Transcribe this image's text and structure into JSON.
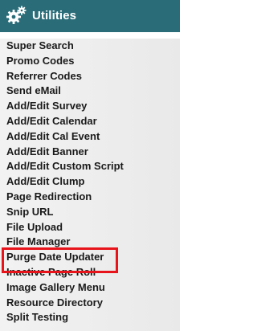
{
  "header": {
    "title": "Utilities",
    "icon": "gears-icon",
    "background_color": "#2a6d79"
  },
  "menu": {
    "items": [
      {
        "label": "Super Search"
      },
      {
        "label": "Promo Codes"
      },
      {
        "label": "Referrer Codes"
      },
      {
        "label": "Send eMail"
      },
      {
        "label": "Add/Edit Survey"
      },
      {
        "label": "Add/Edit Calendar"
      },
      {
        "label": "Add/Edit Cal Event"
      },
      {
        "label": "Add/Edit Banner"
      },
      {
        "label": "Add/Edit Custom Script"
      },
      {
        "label": "Add/Edit Clump"
      },
      {
        "label": "Page Redirection"
      },
      {
        "label": "Snip URL"
      },
      {
        "label": "File Upload"
      },
      {
        "label": "File Manager"
      },
      {
        "label": "Purge Date Updater"
      },
      {
        "label": "Inactive Page Roll"
      },
      {
        "label": "Image Gallery Menu"
      },
      {
        "label": "Resource Directory"
      },
      {
        "label": "Split Testing"
      }
    ]
  },
  "highlight": {
    "target": "Purge Date Updater",
    "color": "#e8141b"
  }
}
